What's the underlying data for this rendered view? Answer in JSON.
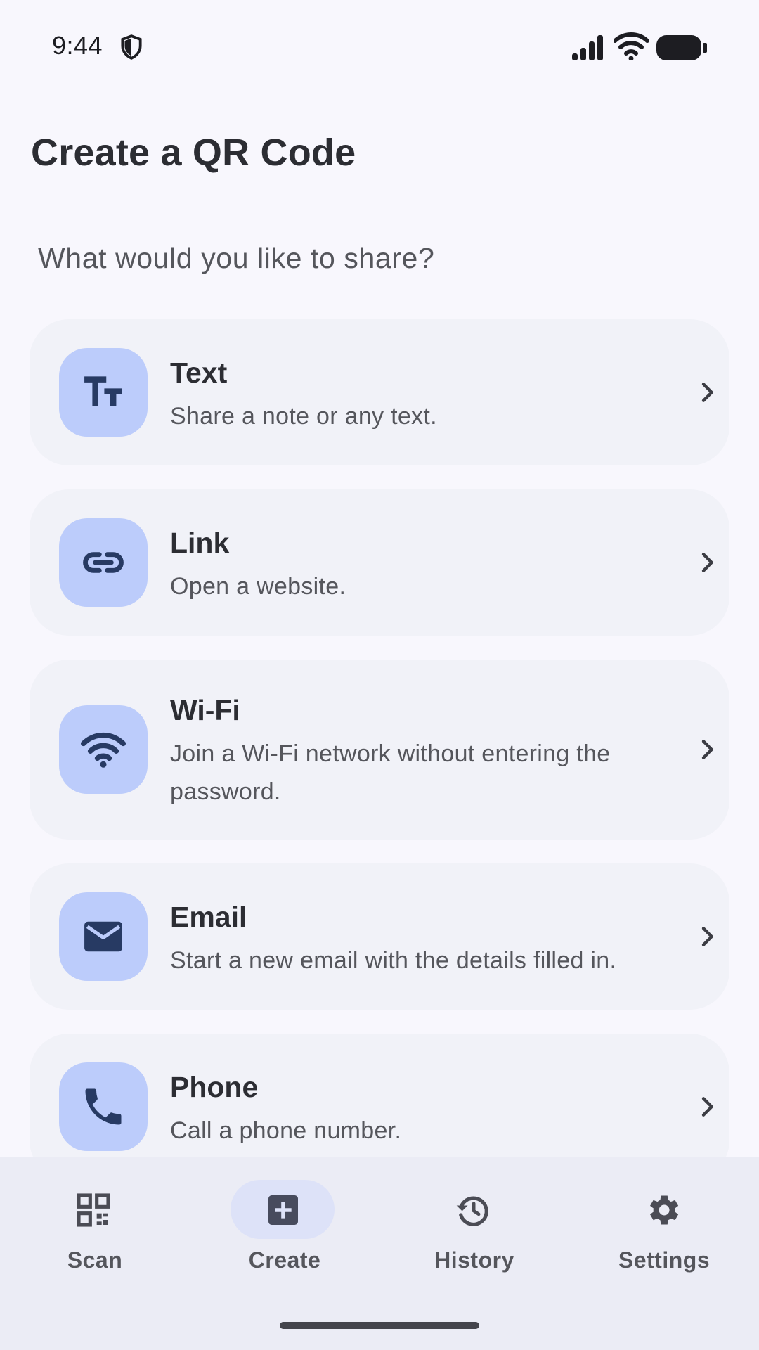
{
  "status_bar": {
    "time": "9:44",
    "icons": [
      "shield-icon",
      "signal-icon",
      "wifi-icon",
      "battery-icon"
    ]
  },
  "header": {
    "title": "Create a QR Code",
    "subtitle": "What would you like to share?"
  },
  "options": [
    {
      "title": "Text",
      "description": "Share a note or any text.",
      "icon": "text-format-icon"
    },
    {
      "title": "Link",
      "description": "Open a website.",
      "icon": "link-icon"
    },
    {
      "title": "Wi-Fi",
      "description": "Join a Wi-Fi network without entering the password.",
      "icon": "wifi-icon"
    },
    {
      "title": "Email",
      "description": "Start a new email with the details filled in.",
      "icon": "mail-icon"
    },
    {
      "title": "Phone",
      "description": "Call a phone number.",
      "icon": "phone-icon"
    }
  ],
  "bottom_nav": {
    "items": [
      {
        "label": "Scan",
        "icon": "qr-scan-icon"
      },
      {
        "label": "Create",
        "icon": "add-box-icon"
      },
      {
        "label": "History",
        "icon": "history-icon"
      },
      {
        "label": "Settings",
        "icon": "gear-icon"
      }
    ],
    "active": "Create"
  },
  "colors": {
    "accent": "#bcccfb",
    "icon_dark": "#273a63",
    "background": "#f8f7fd",
    "card": "#f1f2f8",
    "nav_bg": "#ebecf5"
  }
}
